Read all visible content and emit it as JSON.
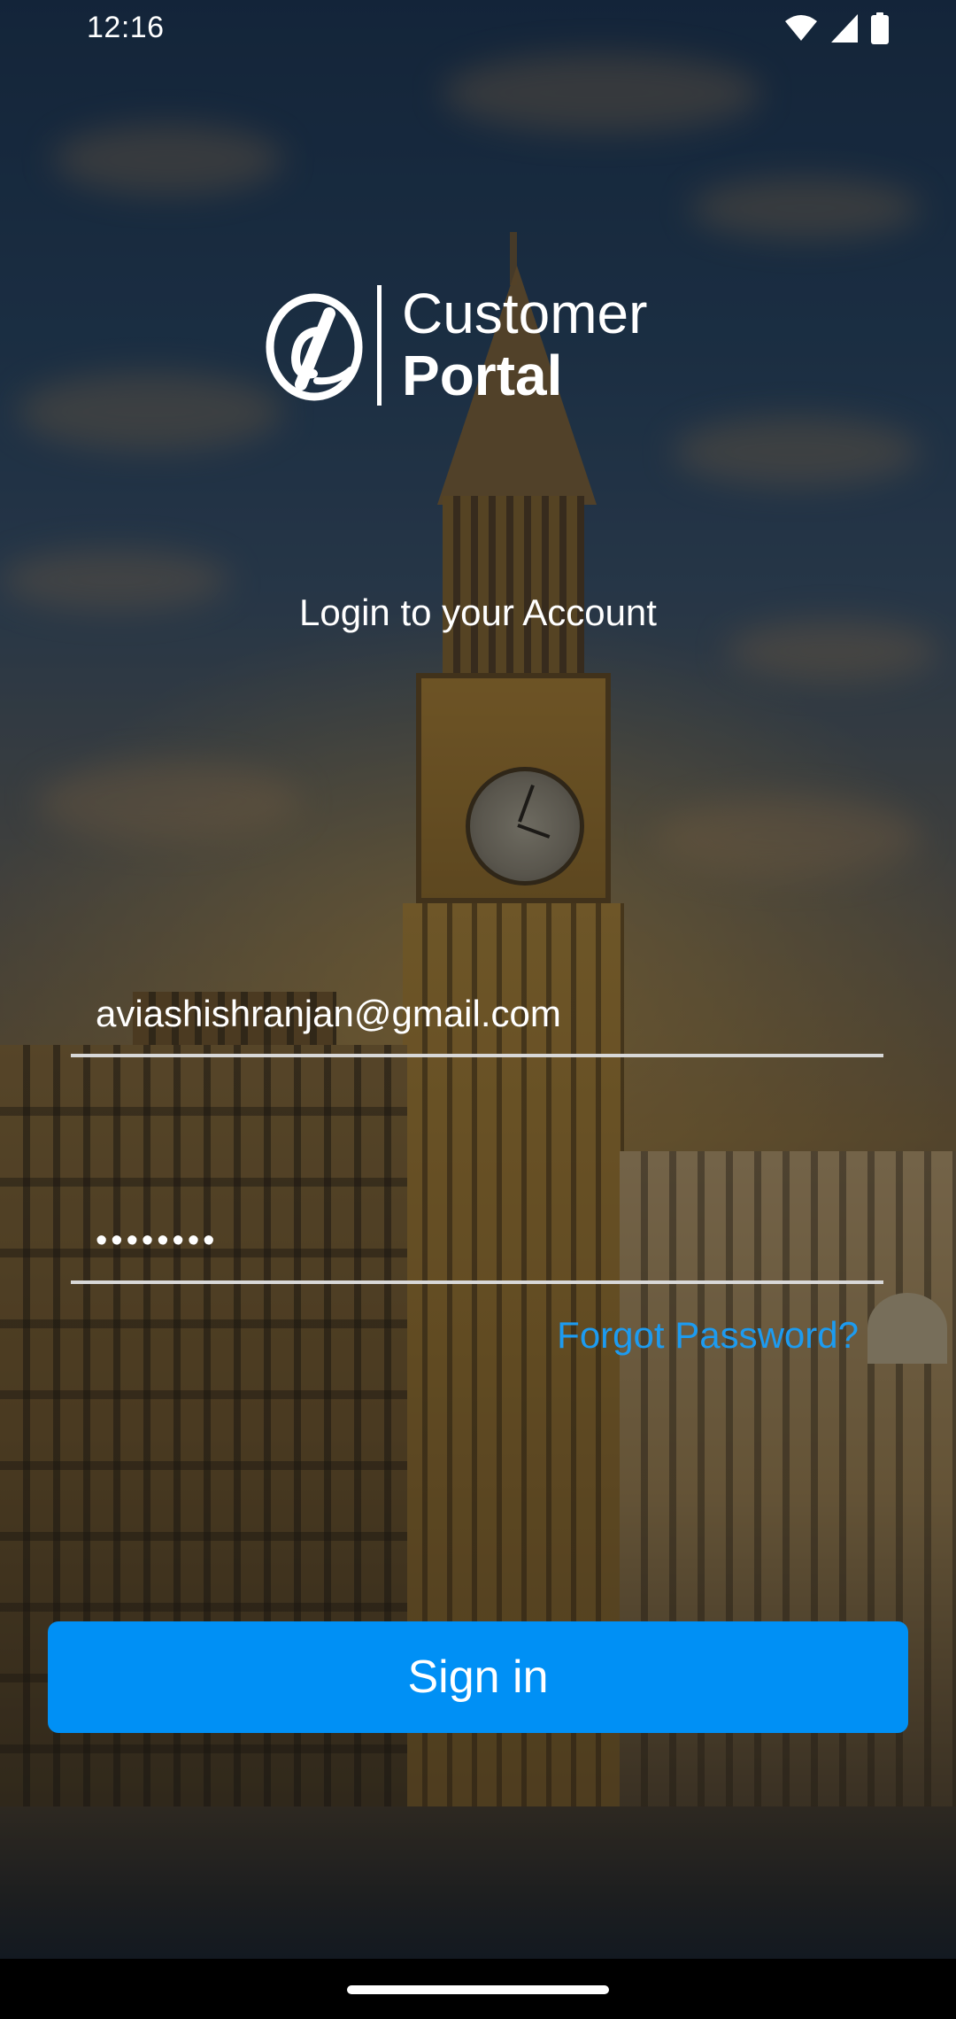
{
  "status_bar": {
    "time": "12:16",
    "icons": [
      "wifi-icon",
      "cell-signal-icon",
      "battery-icon"
    ]
  },
  "logo": {
    "line1": "Customer",
    "line2": "Portal",
    "mark_icon": "at-sign-logo-icon"
  },
  "heading": "Login to your Account",
  "form": {
    "email_value": "aviashishranjan@gmail.com",
    "password_value": "••••••••",
    "forgot_password_label": "Forgot Password?"
  },
  "signin_button_label": "Sign in",
  "colors": {
    "accent": "#0090f5",
    "link": "#1d9bf0",
    "text": "#ffffff"
  }
}
